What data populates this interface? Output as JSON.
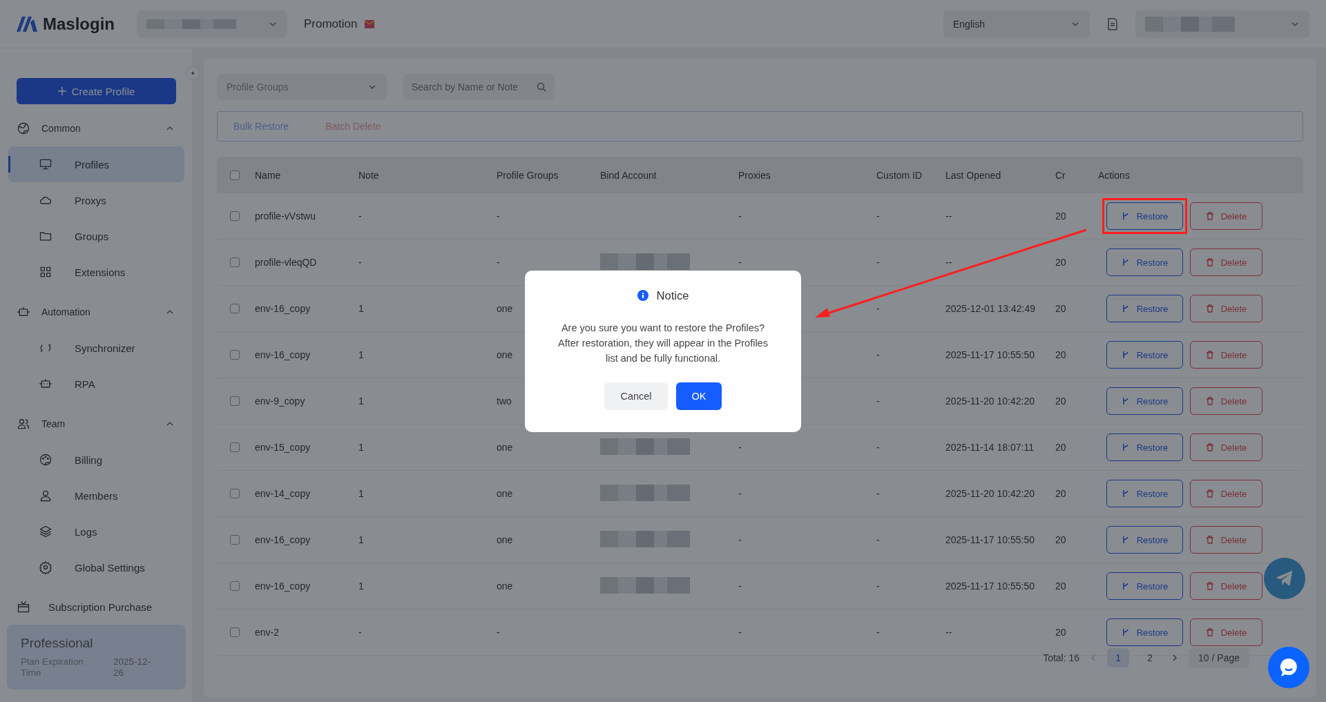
{
  "header": {
    "logo": "Maslogin",
    "promotion": "Promotion",
    "language": "English"
  },
  "sidebar": {
    "create_button": "Create Profile",
    "sections": [
      {
        "label": "Common",
        "expanded": true,
        "items": [
          {
            "label": "Profiles",
            "selected": true
          },
          {
            "label": "Proxys",
            "selected": false
          },
          {
            "label": "Groups",
            "selected": false
          },
          {
            "label": "Extensions",
            "selected": false
          }
        ]
      },
      {
        "label": "Automation",
        "expanded": true,
        "items": [
          {
            "label": "Synchronizer",
            "selected": false
          },
          {
            "label": "RPA",
            "selected": false
          }
        ]
      },
      {
        "label": "Team",
        "expanded": true,
        "items": [
          {
            "label": "Billing",
            "selected": false
          },
          {
            "label": "Members",
            "selected": false
          },
          {
            "label": "Logs",
            "selected": false
          },
          {
            "label": "Global Settings",
            "selected": false
          }
        ]
      }
    ],
    "purchase": "Subscription Purchase",
    "plan": {
      "name": "Professional",
      "expiration_label": "Plan Expiration Time",
      "expiration_value": "2025-12-26"
    }
  },
  "filters": {
    "group_select": {
      "placeholder": "Profile Groups"
    },
    "search": {
      "placeholder": "Search by Name or Note"
    }
  },
  "bulk_actions": [
    {
      "label": "Bulk Restore",
      "kind": "restore",
      "disabled": true
    },
    {
      "label": "Batch Delete",
      "kind": "delete",
      "disabled": true
    }
  ],
  "table": {
    "all_checked": false,
    "columns": [
      "Name",
      "Note",
      "Profile Groups",
      "Bind Account",
      "Proxies",
      "Custom ID",
      "Last Opened",
      "Cr",
      "Actions"
    ],
    "rows": [
      {
        "checked": false,
        "name": "profile-vVstwu",
        "note": "-",
        "profile_groups": "-",
        "bind_redacted": false,
        "proxies": "-",
        "custom_id": "-",
        "last_opened": "--",
        "column_8": "20",
        "restore": "Restore",
        "delete": "Delete",
        "highlighted": true
      },
      {
        "checked": false,
        "name": "profile-vleqQD",
        "note": "-",
        "profile_groups": "-",
        "bind_redacted": true,
        "proxies": "-",
        "custom_id": "-",
        "last_opened": "--",
        "column_8": "20",
        "restore": "Restore",
        "delete": "Delete",
        "highlighted": false
      },
      {
        "checked": false,
        "name": "env-16_copy",
        "note": "1",
        "profile_groups": "one",
        "custom_id": "-",
        "last_opened": "2025-12-01 13:42:49",
        "column_8": "20",
        "restore": "Restore",
        "delete": "Delete",
        "highlighted": false
      },
      {
        "checked": false,
        "name": "env-16_copy",
        "note": "1",
        "profile_groups": "one",
        "custom_id": "-",
        "last_opened": "2025-11-17 10:55:50",
        "column_8": "20",
        "restore": "Restore",
        "delete": "Delete",
        "highlighted": false
      },
      {
        "checked": false,
        "name": "env-9_copy",
        "note": "1",
        "profile_groups": "two",
        "custom_id": "-",
        "last_opened": "2025-11-20 10:42:20",
        "column_8": "20",
        "restore": "Restore",
        "delete": "Delete",
        "highlighted": false
      },
      {
        "checked": false,
        "name": "env-15_copy",
        "note": "1",
        "profile_groups": "one",
        "bind_redacted": true,
        "proxies": "-",
        "custom_id": "-",
        "last_opened": "2025-11-14 18:07:11",
        "column_8": "20",
        "restore": "Restore",
        "delete": "Delete",
        "highlighted": false
      },
      {
        "checked": false,
        "name": "env-14_copy",
        "note": "1",
        "profile_groups": "one",
        "bind_redacted": true,
        "proxies": "-",
        "custom_id": "-",
        "last_opened": "2025-11-20 10:42:20",
        "column_8": "20",
        "restore": "Restore",
        "delete": "Delete",
        "highlighted": false
      },
      {
        "checked": false,
        "name": "env-16_copy",
        "note": "1",
        "profile_groups": "one",
        "bind_redacted": true,
        "proxies": "-",
        "custom_id": "-",
        "last_opened": "2025-11-17 10:55:50",
        "column_8": "20",
        "restore": "Restore",
        "delete": "Delete",
        "highlighted": false
      },
      {
        "checked": false,
        "name": "env-16_copy",
        "note": "1",
        "profile_groups": "one",
        "bind_redacted": true,
        "proxies": "-",
        "custom_id": "-",
        "last_opened": "2025-11-17 10:55:50",
        "column_8": "20",
        "restore": "Restore",
        "delete": "Delete",
        "highlighted": false
      },
      {
        "checked": false,
        "name": "env-2",
        "note": "-",
        "profile_groups": "-",
        "bind_redacted": false,
        "proxies": "-",
        "custom_id": "-",
        "last_opened": "--",
        "column_8": "20",
        "restore": "Restore",
        "delete": "Delete",
        "highlighted": false
      }
    ]
  },
  "pagination": {
    "total": "Total: 16",
    "pages": [
      {
        "label": "1",
        "selected": true
      },
      {
        "label": "2",
        "selected": false
      }
    ],
    "page_size": "10 / Page"
  },
  "dialog": {
    "title": "Notice",
    "message": "Are you sure you want to restore the Profiles? After restoration, they will appear in the Profiles list and be fully functional.",
    "buttons": [
      {
        "label": "Cancel",
        "kind": "secondary"
      },
      {
        "label": "OK",
        "kind": "primary"
      }
    ]
  }
}
